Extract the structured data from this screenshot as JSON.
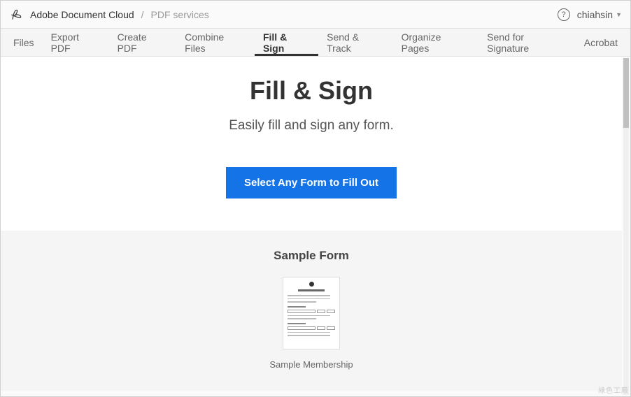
{
  "header": {
    "breadcrumb_main": "Adobe Document Cloud",
    "breadcrumb_sub": "PDF services",
    "username": "chiahsin"
  },
  "tabs": [
    {
      "label": "Files",
      "active": false
    },
    {
      "label": "Export PDF",
      "active": false
    },
    {
      "label": "Create PDF",
      "active": false
    },
    {
      "label": "Combine Files",
      "active": false
    },
    {
      "label": "Fill & Sign",
      "active": true
    },
    {
      "label": "Send & Track",
      "active": false
    },
    {
      "label": "Organize Pages",
      "active": false
    },
    {
      "label": "Send for Signature",
      "active": false
    },
    {
      "label": "Acrobat",
      "active": false
    }
  ],
  "hero": {
    "title": "Fill & Sign",
    "subtitle": "Easily fill and sign any form.",
    "cta_label": "Select Any Form to Fill Out"
  },
  "sample": {
    "section_title": "Sample Form",
    "item_name": "Sample Membership"
  },
  "colors": {
    "primary_button": "#1473E6"
  },
  "watermark": "綠色工廠"
}
